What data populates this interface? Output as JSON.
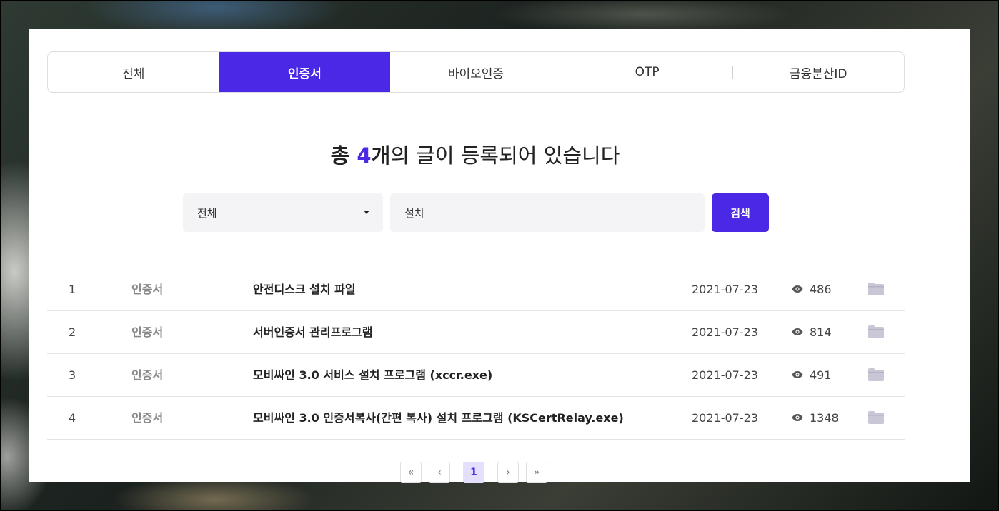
{
  "tabs": [
    {
      "label": "전체"
    },
    {
      "label": "인증서"
    },
    {
      "label": "바이오인증"
    },
    {
      "label": "OTP"
    },
    {
      "label": "금융분산ID"
    }
  ],
  "summary": {
    "prefix": "총 ",
    "count": "4",
    "unit": "개",
    "suffix": "의 글이 등록되어 있습니다"
  },
  "search": {
    "filter_selected": "전체",
    "query": "설치",
    "button_label": "검색"
  },
  "rows": [
    {
      "num": "1",
      "category": "인증서",
      "title": "안전디스크 설치 파일",
      "date": "2021-07-23",
      "views": "486"
    },
    {
      "num": "2",
      "category": "인증서",
      "title": "서버인증서 관리프로그램",
      "date": "2021-07-23",
      "views": "814"
    },
    {
      "num": "3",
      "category": "인증서",
      "title": "모비싸인 3.0 서비스 설치 프로그램 (xccr.exe)",
      "date": "2021-07-23",
      "views": "491"
    },
    {
      "num": "4",
      "category": "인증서",
      "title": "모비싸인 3.0 인증서복사(간편 복사) 설치 프로그램 (KSCertRelay.exe)",
      "date": "2021-07-23",
      "views": "1348"
    }
  ],
  "pagination": {
    "first": "«",
    "prev": "‹",
    "current": "1",
    "next": "›",
    "last": "»"
  },
  "colors": {
    "accent": "#4a28e6",
    "accent_light": "#e3dffc",
    "input_bg": "#f4f4f6",
    "folder": "#c9c7d6"
  }
}
